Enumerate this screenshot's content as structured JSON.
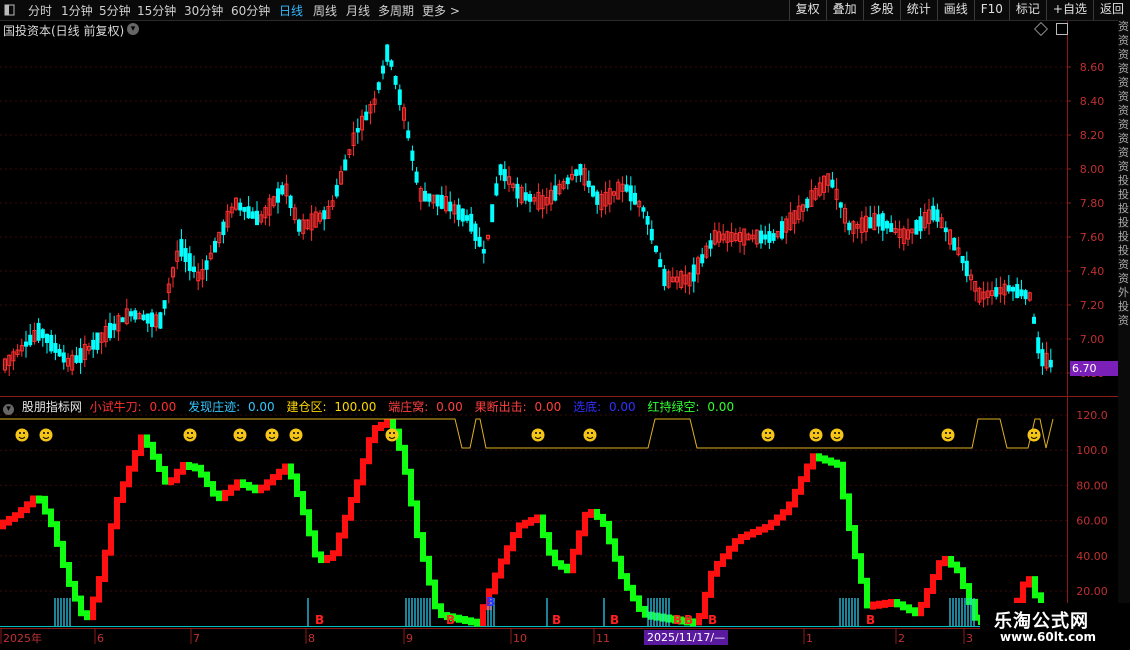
{
  "toolbar": {
    "periods": [
      "分时",
      "1分钟",
      "5分钟",
      "15分钟",
      "30分钟",
      "60分钟",
      "日线",
      "周线",
      "月线",
      "多周期",
      "更多 >"
    ],
    "active_period": "日线",
    "buttons": [
      "复权",
      "叠加",
      "多股",
      "统计",
      "画线",
      "F10",
      "标记",
      "+自选",
      "返回"
    ]
  },
  "main_chart": {
    "title": "国投资本(日线 前复权)",
    "price_axis": [
      "8.60",
      "8.40",
      "8.20",
      "8.00",
      "7.80",
      "7.60",
      "7.40",
      "7.20",
      "7.00",
      "6.80"
    ],
    "last_price": "6.70",
    "price_range": [
      6.78,
      8.76
    ],
    "up_color": "#ff3030",
    "down_color": "#00ffff"
  },
  "indicator": {
    "name": "股朋指标网",
    "fields": [
      {
        "label": "小试牛刀:",
        "value": "0.00",
        "color": "#ff3030"
      },
      {
        "label": "发现庄迹:",
        "value": "0.00",
        "color": "#35c8ff"
      },
      {
        "label": "建仓区:",
        "value": "100.00",
        "color": "#ffd700"
      },
      {
        "label": "端庄窝:",
        "value": "0.00",
        "color": "#ff4040"
      },
      {
        "label": "果断出击:",
        "value": "0.00",
        "color": "#ff4040"
      },
      {
        "label": "选底:",
        "value": "0.00",
        "color": "#3030ff"
      },
      {
        "label": "红持绿空:",
        "value": "0.00",
        "color": "#30ff30"
      }
    ],
    "axis": [
      "120.0",
      "100.0",
      "80.00",
      "60.00",
      "40.00",
      "20.00"
    ],
    "marker_letter": "B",
    "smiley": "☺"
  },
  "date_axis": {
    "labels": [
      "2025年",
      "6",
      "7",
      "8",
      "9",
      "10",
      "11",
      "1",
      "2",
      "3"
    ],
    "cursor_date": "2025/11/17/—"
  },
  "side_strip_text": "资资资资资资资资资资资投投投投投投资资外投资",
  "watermark": {
    "line1": "乐淘公式网",
    "line2": "www.60lt.com"
  }
}
